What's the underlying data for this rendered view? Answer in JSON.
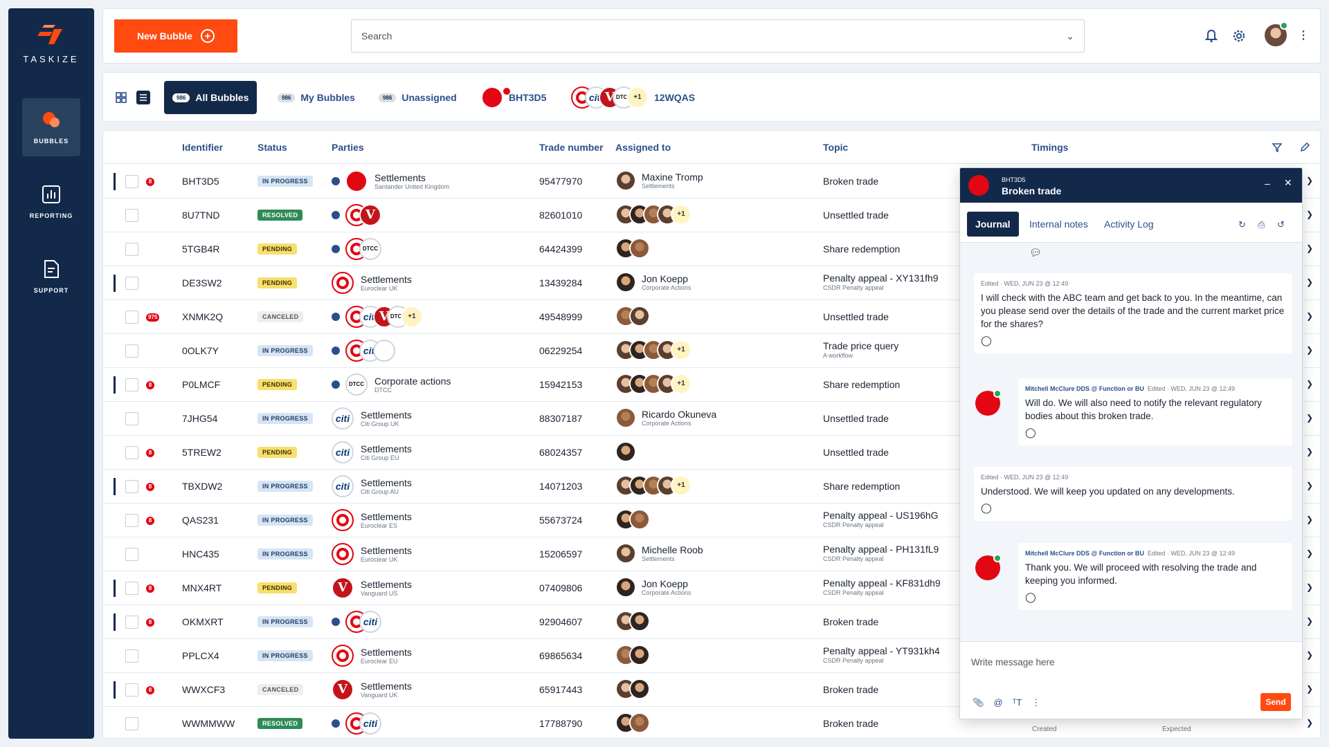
{
  "brand": {
    "name": "TASKIZE",
    "accent": "#ff4a10",
    "navy": "#13294a"
  },
  "nav": [
    {
      "label": "BUBBLES",
      "icon": "bubbles-icon",
      "active": true
    },
    {
      "label": "REPORTING",
      "icon": "reporting-icon",
      "active": false
    },
    {
      "label": "SUPPORT",
      "icon": "support-icon",
      "active": false
    }
  ],
  "topbar": {
    "new_bubble_label": "New Bubble",
    "search_placeholder": "Search"
  },
  "tabs": [
    {
      "label": "All Bubbles",
      "count": "986",
      "active": true
    },
    {
      "label": "My Bubbles",
      "count": "986",
      "active": false
    },
    {
      "label": "Unassigned",
      "count": "986",
      "active": false
    },
    {
      "label": "BHT3D5",
      "count": "",
      "active": false
    },
    {
      "label": "12WQAS",
      "count": "",
      "active": false
    }
  ],
  "tab_12wqas_more": "+1",
  "table": {
    "headers": [
      "Identifier",
      "Status",
      "Parties",
      "Trade number",
      "Assigned to",
      "Topic",
      "Timings"
    ],
    "rows": [
      {
        "id": "BHT3D5",
        "selected": true,
        "alert": "8",
        "status": "IN PROGRESS",
        "parties": [
          "santander"
        ],
        "party_name": "Settlements",
        "party_sub": "Santander United Kingdom",
        "trade": "95477970",
        "assignees": [
          "a1"
        ],
        "assign_name": "Maxine Tromp",
        "assign_sub": "Settlements",
        "topic": "Broken trade",
        "topic_sub": ""
      },
      {
        "id": "8U7TND",
        "selected": false,
        "alert": "",
        "status": "RESOLVED",
        "parties": [
          "euroclear",
          "vanguard"
        ],
        "party_name": "",
        "party_sub": "",
        "trade": "82601010",
        "assignees": [
          "a1",
          "a2",
          "a3",
          "a1"
        ],
        "more": "+1",
        "assign_name": "",
        "assign_sub": "",
        "topic": "Unsettled trade",
        "topic_sub": ""
      },
      {
        "id": "5TGB4R",
        "selected": false,
        "alert": "",
        "status": "PENDING",
        "parties": [
          "euroclear",
          "dtcc"
        ],
        "party_name": "",
        "party_sub": "",
        "trade": "64424399",
        "assignees": [
          "a2",
          "a3"
        ],
        "assign_name": "",
        "assign_sub": "",
        "topic": "Share redemption",
        "topic_sub": ""
      },
      {
        "id": "DE3SW2",
        "selected": true,
        "alert": "",
        "status": "PENDING",
        "parties": [
          "euroclear"
        ],
        "party_name": "Settlements",
        "party_sub": "Euroclear UK",
        "trade": "13439284",
        "assignees": [
          "a2"
        ],
        "assign_name": "Jon Koepp",
        "assign_sub": "Corporate Actions",
        "topic": "Penalty appeal - XY131fh9",
        "topic_sub": "CSDR Penalty appeal"
      },
      {
        "id": "XNMK2Q",
        "selected": false,
        "alert": "975",
        "status": "CANCELED",
        "parties": [
          "euroclear",
          "citi",
          "vanguard",
          "dtcc"
        ],
        "party_more": "+1",
        "party_name": "",
        "party_sub": "",
        "trade": "49548999",
        "assignees": [
          "a3",
          "a1"
        ],
        "assign_name": "",
        "assign_sub": "",
        "topic": "Unsettled trade",
        "topic_sub": ""
      },
      {
        "id": "0OLK7Y",
        "selected": false,
        "alert": "",
        "status": "IN PROGRESS",
        "parties": [
          "euroclear",
          "citi",
          "bank"
        ],
        "party_name": "",
        "party_sub": "",
        "trade": "06229254",
        "assignees": [
          "a1",
          "a2",
          "a3",
          "a1"
        ],
        "more": "+1",
        "assign_name": "",
        "assign_sub": "",
        "topic": "Trade price query",
        "topic_sub": "A workflow"
      },
      {
        "id": "P0LMCF",
        "selected": true,
        "alert": "8",
        "status": "PENDING",
        "parties": [
          "dtcc"
        ],
        "party_name": "Corporate actions",
        "party_sub": "DTCC",
        "trade": "15942153",
        "assignees": [
          "a1",
          "a2",
          "a3",
          "a1"
        ],
        "more": "+1",
        "assign_name": "",
        "assign_sub": "",
        "topic": "Share redemption",
        "topic_sub": ""
      },
      {
        "id": "7JHG54",
        "selected": false,
        "alert": "",
        "status": "IN PROGRESS",
        "parties": [
          "citi"
        ],
        "party_name": "Settlements",
        "party_sub": "Citi Group UK",
        "trade": "88307187",
        "assignees": [
          "a3"
        ],
        "assign_name": "Ricardo Okuneva",
        "assign_sub": "Corporate Actions",
        "topic": "Unsettled trade",
        "topic_sub": ""
      },
      {
        "id": "5TREW2",
        "selected": false,
        "alert": "8",
        "status": "PENDING",
        "parties": [
          "citi"
        ],
        "party_name": "Settlements",
        "party_sub": "Citi Group EU",
        "trade": "68024357",
        "assignees": [
          "a2"
        ],
        "assign_name": "",
        "assign_sub": "",
        "topic": "Unsettled trade",
        "topic_sub": ""
      },
      {
        "id": "TBXDW2",
        "selected": true,
        "alert": "8",
        "status": "IN PROGRESS",
        "parties": [
          "citi"
        ],
        "party_name": "Settlements",
        "party_sub": "Citi Group AU",
        "trade": "14071203",
        "assignees": [
          "a1",
          "a2",
          "a3",
          "a1"
        ],
        "more": "+1",
        "assign_name": "",
        "assign_sub": "",
        "topic": "Share redemption",
        "topic_sub": ""
      },
      {
        "id": "QAS231",
        "selected": false,
        "alert": "8",
        "status": "IN PROGRESS",
        "parties": [
          "euroclear"
        ],
        "party_name": "Settlements",
        "party_sub": "Euroclear ES",
        "trade": "55673724",
        "assignees": [
          "a2",
          "a3"
        ],
        "assign_name": "",
        "assign_sub": "",
        "topic": "Penalty appeal - US196hG",
        "topic_sub": "CSDR Penalty appeal"
      },
      {
        "id": "HNC435",
        "selected": false,
        "alert": "",
        "status": "IN PROGRESS",
        "parties": [
          "euroclear"
        ],
        "party_name": "Settlements",
        "party_sub": "Euroclear UK",
        "trade": "15206597",
        "assignees": [
          "a1"
        ],
        "assign_name": "Michelle Roob",
        "assign_sub": "Settlements",
        "topic": "Penalty appeal - PH131fL9",
        "topic_sub": "CSDR Penalty appeal"
      },
      {
        "id": "MNX4RT",
        "selected": true,
        "alert": "8",
        "status": "PENDING",
        "parties": [
          "vanguard"
        ],
        "party_name": "Settlements",
        "party_sub": "Vanguard US",
        "trade": "07409806",
        "assignees": [
          "a2"
        ],
        "assign_name": "Jon Koepp",
        "assign_sub": "Corporate Actions",
        "topic": "Penalty appeal - KF831dh9",
        "topic_sub": "CSDR Penalty appeal"
      },
      {
        "id": "OKMXRT",
        "selected": true,
        "alert": "8",
        "status": "IN PROGRESS",
        "parties": [
          "euroclear",
          "citi"
        ],
        "party_name": "",
        "party_sub": "",
        "trade": "92904607",
        "assignees": [
          "a1",
          "a2"
        ],
        "assign_name": "",
        "assign_sub": "",
        "topic": "Broken trade",
        "topic_sub": ""
      },
      {
        "id": "PPLCX4",
        "selected": false,
        "alert": "",
        "status": "IN PROGRESS",
        "parties": [
          "euroclear"
        ],
        "party_name": "Settlements",
        "party_sub": "Euroclear EU",
        "trade": "69865634",
        "assignees": [
          "a3",
          "a2"
        ],
        "assign_name": "",
        "assign_sub": "",
        "topic": "Penalty appeal - YT931kh4",
        "topic_sub": "CSDR Penalty appeal"
      },
      {
        "id": "WWXCF3",
        "selected": true,
        "alert": "8",
        "status": "CANCELED",
        "parties": [
          "vanguard"
        ],
        "party_name": "Settlements",
        "party_sub": "Vanguard UK",
        "trade": "65917443",
        "assignees": [
          "a1",
          "a2"
        ],
        "assign_name": "",
        "assign_sub": "",
        "topic": "Broken trade",
        "topic_sub": ""
      },
      {
        "id": "WWMMWW",
        "selected": false,
        "alert": "",
        "status": "RESOLVED",
        "parties": [
          "euroclear",
          "citi"
        ],
        "party_name": "",
        "party_sub": "",
        "trade": "17788790",
        "assignees": [
          "a2",
          "a3"
        ],
        "assign_name": "",
        "assign_sub": "",
        "topic": "Broken trade",
        "topic_sub": ""
      }
    ],
    "timings_peek": {
      "created": "Created",
      "expected": "Expected"
    }
  },
  "panel": {
    "bubble_id": "BHT3D5",
    "title": "Broken trade",
    "tabs": [
      "Journal",
      "Internal notes",
      "Activity Log"
    ],
    "messages": [
      {
        "meta_prefix": "Edited",
        "meta_time": "WED, JUN 23 @ 12:49",
        "author": "",
        "group": "",
        "text": "I will check with the ABC team and get back to you. In the meantime, can you please send over the details of the trade and the current market price for the shares?",
        "mine": true
      },
      {
        "meta_prefix": "Edited",
        "meta_time": "WED, JUN 23 @ 12:49",
        "author": "Mitchell McClure DDS",
        "group": "Function or BU",
        "text": "Will do. We will also need to notify the relevant regulatory bodies about this broken trade.",
        "mine": false
      },
      {
        "meta_prefix": "Edited",
        "meta_time": "WED, JUN 23 @ 12:49",
        "author": "",
        "group": "",
        "text": "Understood. We will keep you updated on any developments.",
        "mine": true
      },
      {
        "meta_prefix": "Edited",
        "meta_time": "WED, JUN 23 @ 12:49",
        "author": "Mitchell McClure DDS",
        "group": "Function or BU",
        "text": "Thank you. We will proceed with resolving the trade and keeping you informed.",
        "mine": false
      }
    ],
    "compose_placeholder": "Write message here",
    "send_label": "Send"
  }
}
